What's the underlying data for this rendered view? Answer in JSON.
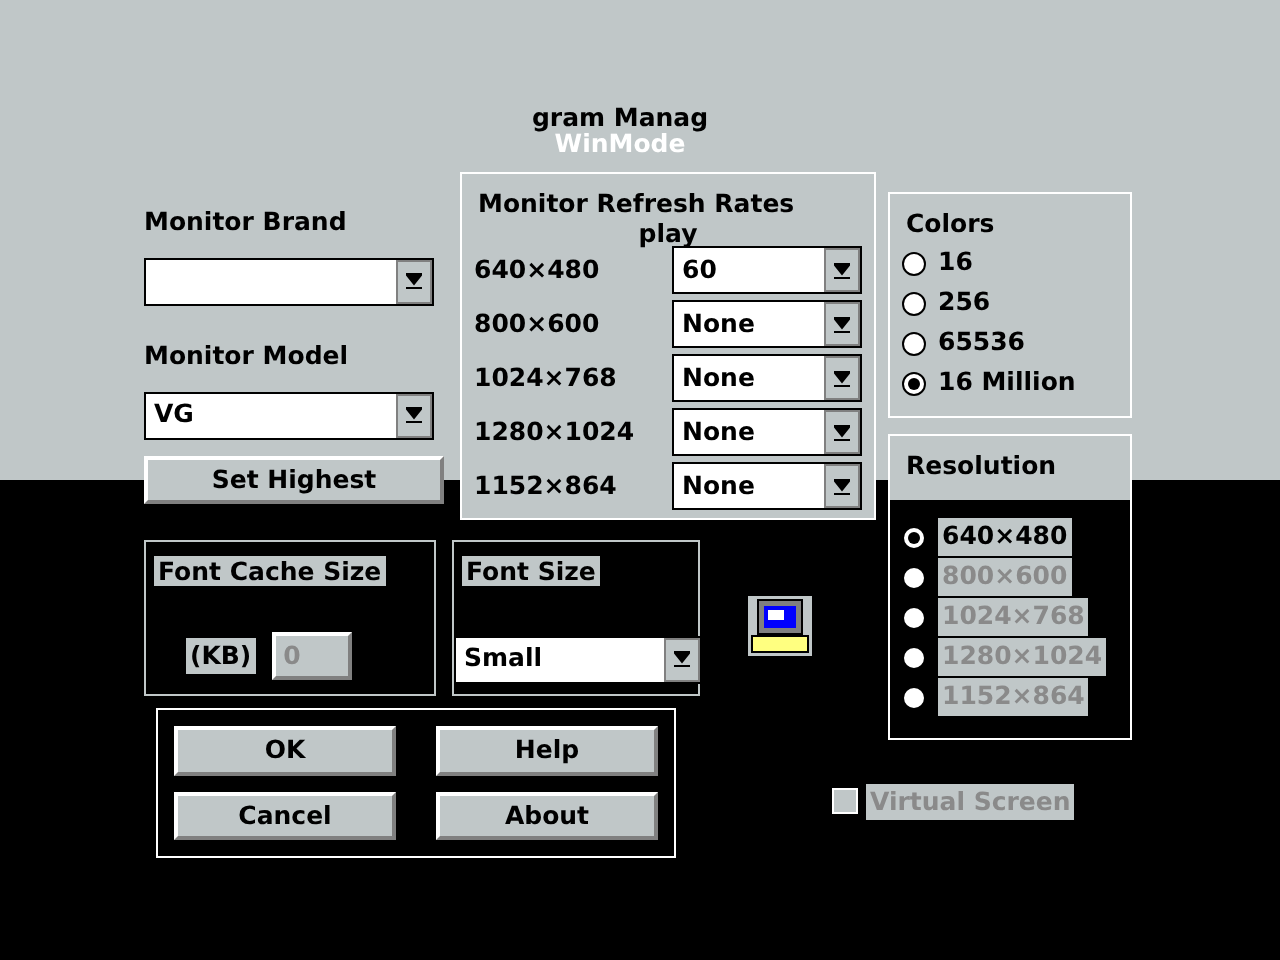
{
  "title": {
    "text": "gram Manag",
    "subtitle": "WinMode"
  },
  "monitor": {
    "brand_label": "Monitor Brand",
    "model_label": "Monitor Model",
    "model_value": "VG",
    "set_highest": "Set Highest"
  },
  "refresh_rates": {
    "title": "Monitor Refresh Rates",
    "caption": "play",
    "rows": [
      {
        "resolution": "640×480",
        "rate": "60"
      },
      {
        "resolution": "800×600",
        "rate": "None"
      },
      {
        "resolution": "1024×768",
        "rate": "None"
      },
      {
        "resolution": "1280×1024",
        "rate": "None"
      },
      {
        "resolution": "1152×864",
        "rate": "None"
      }
    ]
  },
  "colors": {
    "title": "Colors",
    "options": [
      {
        "label": "16",
        "selected": false
      },
      {
        "label": "256",
        "selected": false
      },
      {
        "label": "65536",
        "selected": false
      },
      {
        "label": "16 Million",
        "selected": true
      }
    ]
  },
  "resolution": {
    "title": "Resolution",
    "options": [
      {
        "label": "640×480",
        "selected": true,
        "disabled": false
      },
      {
        "label": "800×600",
        "selected": false,
        "disabled": true
      },
      {
        "label": "1024×768",
        "selected": false,
        "disabled": true
      },
      {
        "label": "1280×1024",
        "selected": false,
        "disabled": true
      },
      {
        "label": "1152×864",
        "selected": false,
        "disabled": true
      }
    ]
  },
  "font_cache": {
    "title": "Font Cache Size",
    "unit": "(KB)",
    "value": "0",
    "disabled": true
  },
  "font_size": {
    "title": "Font Size",
    "value": "Small"
  },
  "buttons": [
    "OK",
    "Help",
    "Cancel",
    "About"
  ],
  "virtual_screen": {
    "label": "Virtual Screen",
    "checked": false,
    "disabled": true
  }
}
